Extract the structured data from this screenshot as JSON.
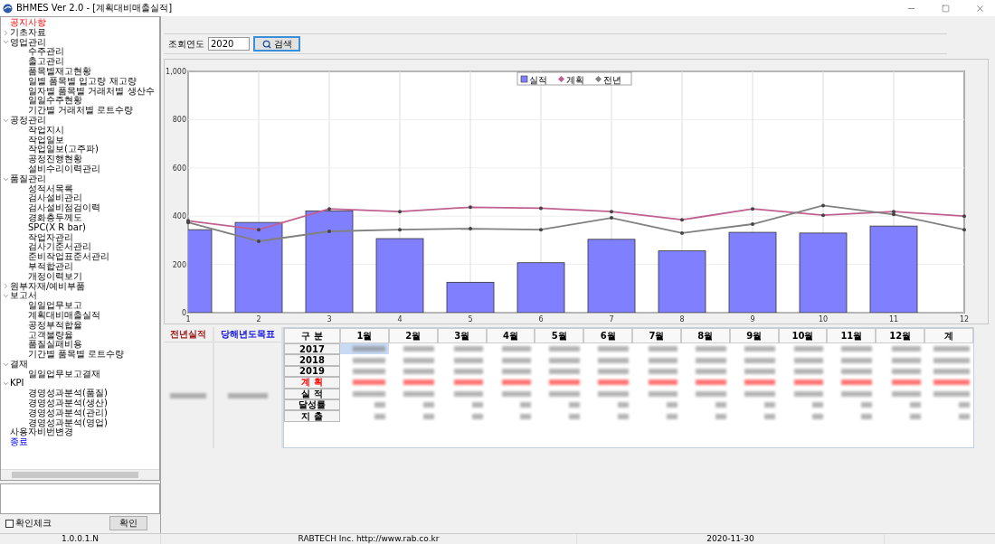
{
  "window": {
    "title": "BHMES Ver 2.0 - [계획대비매출실적]"
  },
  "sidebar": {
    "items": [
      {
        "label": "공지사항",
        "kind": "notice"
      },
      {
        "label": "기초자료",
        "kind": "menu",
        "expanded": false
      },
      {
        "label": "영업관리",
        "kind": "menu",
        "expanded": true,
        "children": [
          {
            "label": "수주관리"
          },
          {
            "label": "출고관리"
          },
          {
            "label": "품목별재고현황"
          },
          {
            "label": "일별 품목별 입고량 재고량"
          },
          {
            "label": "일자별 품목별 거래처별 생산수"
          },
          {
            "label": "일일수주현황"
          },
          {
            "label": "기간별 거래처별 로트수량"
          }
        ]
      },
      {
        "label": "공정관리",
        "kind": "menu",
        "expanded": true,
        "children": [
          {
            "label": "작업지시"
          },
          {
            "label": "작업일보"
          },
          {
            "label": "작업일보(고주파)"
          },
          {
            "label": "공정진행현황"
          },
          {
            "label": "설비수리이력관리"
          }
        ]
      },
      {
        "label": "품질관리",
        "kind": "menu",
        "expanded": true,
        "children": [
          {
            "label": "성적서목록"
          },
          {
            "label": "검사설비관리"
          },
          {
            "label": "검사설비점검이력"
          },
          {
            "label": "경화층두께도"
          },
          {
            "label": "SPC(X R bar)"
          },
          {
            "label": "작업자관리"
          },
          {
            "label": "검사기준서관리"
          },
          {
            "label": "준비작업표준서관리"
          },
          {
            "label": "부적합관리"
          },
          {
            "label": "개정이력보기"
          }
        ]
      },
      {
        "label": "원부자재/예비부품",
        "kind": "menu",
        "expanded": false
      },
      {
        "label": "보고서",
        "kind": "menu",
        "expanded": true,
        "children": [
          {
            "label": "일일업무보고"
          },
          {
            "label": "계획대비매출실적"
          },
          {
            "label": "공정부적합율"
          },
          {
            "label": "고객불량율"
          },
          {
            "label": "품질실패비용"
          },
          {
            "label": "기간별 품목별 로트수량"
          }
        ]
      },
      {
        "label": "결재",
        "kind": "menu",
        "expanded": true,
        "children": [
          {
            "label": "일일업무보고결재"
          }
        ]
      },
      {
        "label": "KPI",
        "kind": "menu",
        "expanded": true,
        "children": [
          {
            "label": "경영성과분석(품질)"
          },
          {
            "label": "경영성과분석(생산)"
          },
          {
            "label": "경영성과분석(관리)"
          },
          {
            "label": "경영성과분석(영업)"
          }
        ]
      },
      {
        "label": "사용자비번변경",
        "kind": "menu"
      },
      {
        "label": "종료",
        "kind": "exit"
      }
    ]
  },
  "confirm_check": {
    "label": "확인체크",
    "checked": false
  },
  "confirm_button": "확인",
  "search": {
    "label": "조회연도",
    "value": "2020",
    "button": "검색"
  },
  "chart": {
    "chart_data": {
      "type": "bar",
      "grid": true,
      "legend": true,
      "x": [
        1,
        2,
        3,
        4,
        5,
        6,
        7,
        8,
        9,
        10,
        11,
        12
      ],
      "xlim": [
        1,
        12
      ],
      "ylim": [
        0,
        1000
      ],
      "xticks": [
        1,
        2,
        3,
        4,
        5,
        6,
        7,
        8,
        9,
        10,
        11,
        12
      ],
      "yticks": [
        0,
        200,
        400,
        600,
        800,
        {
          "value": 1000,
          "label": "1,000"
        }
      ],
      "series": [
        {
          "name": "실적",
          "type": "bar",
          "color": "#8080ff",
          "values": [
            344,
            374,
            422,
            307,
            126,
            207,
            304,
            256,
            333,
            330,
            359,
            null
          ]
        },
        {
          "name": "계획",
          "type": "line",
          "color": "#c06090",
          "values": [
            381,
            344,
            430,
            419,
            437,
            433,
            419,
            385,
            430,
            404,
            419,
            400
          ]
        },
        {
          "name": "전년",
          "type": "line",
          "color": "#808080",
          "values": [
            374,
            296,
            337,
            344,
            348,
            344,
            393,
            330,
            367,
            444,
            407,
            344
          ]
        }
      ]
    }
  },
  "table": {
    "prev_header": "전년실적",
    "target_header": "당해년도목표",
    "corner": "구 분",
    "columns": [
      "1월",
      "2월",
      "3월",
      "4월",
      "5월",
      "6월",
      "7월",
      "8월",
      "9월",
      "10월",
      "11월",
      "12월",
      "계"
    ],
    "rows": [
      {
        "label": "2017",
        "color": "#000000",
        "selected": true
      },
      {
        "label": "2018",
        "color": "#000000",
        "selected": false
      },
      {
        "label": "2019",
        "color": "#000000",
        "selected": false
      },
      {
        "label": "계 획",
        "color": "#ff0000",
        "selected": false
      },
      {
        "label": "실 적",
        "color": "#000000",
        "selected": false
      },
      {
        "label": "달성률",
        "color": "#000000",
        "selected": false
      },
      {
        "label": "지 출",
        "color": "#000000",
        "selected": false
      }
    ]
  },
  "status_bar": {
    "version": "1.0.0.1.N",
    "company": "RABTECH Inc.  http://www.rab.co.kr",
    "date": "2020-11-30"
  }
}
